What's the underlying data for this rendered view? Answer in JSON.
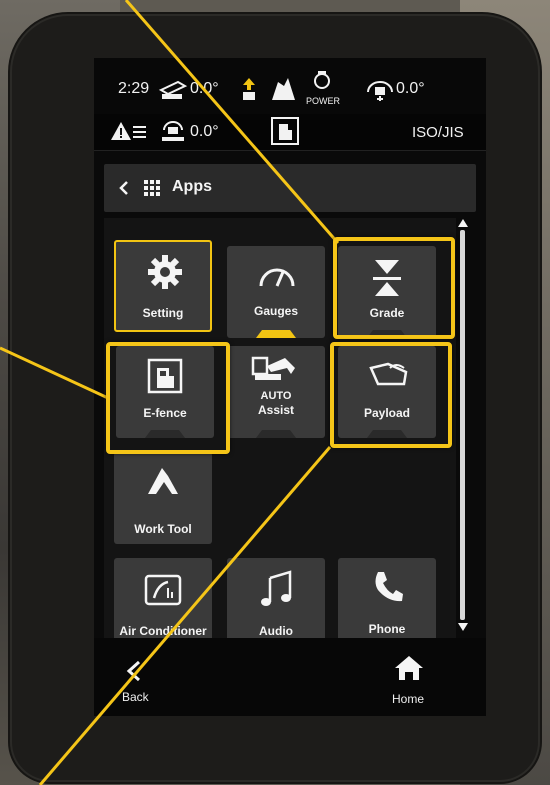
{
  "status": {
    "time": "2:29",
    "angle1": "0.0°",
    "power_label": "POWER",
    "angle2": "0.0°",
    "angle3": "0.0°",
    "iso_label": "ISO/JIS"
  },
  "header": {
    "back_icon": "chevron-left-icon",
    "grid_icon": "apps-grid-icon",
    "title": "Apps"
  },
  "tiles": [
    {
      "label": "Setting",
      "icon": "gear-icon"
    },
    {
      "label": "Gauges",
      "icon": "gauge-icon"
    },
    {
      "label": "Grade",
      "icon": "grade-icon"
    },
    {
      "label": "E-fence",
      "icon": "excavator-fence-icon"
    },
    {
      "label": "AUTO",
      "label2": "Assist",
      "icon": "excavator-icon"
    },
    {
      "label": "Payload",
      "icon": "payload-bucket-icon"
    },
    {
      "label": "Work Tool",
      "icon": "work-tool-icon"
    },
    {
      "label": "Air Conditioner",
      "icon": "air-conditioner-icon"
    },
    {
      "label": "Audio",
      "icon": "music-note-icon"
    },
    {
      "label": "Phone",
      "icon": "phone-icon"
    }
  ],
  "nav": {
    "back": "Back",
    "home": "Home"
  },
  "colors": {
    "highlight": "#f5c518",
    "tile": "#3a3a3a",
    "screen": "#0a0a0a"
  }
}
